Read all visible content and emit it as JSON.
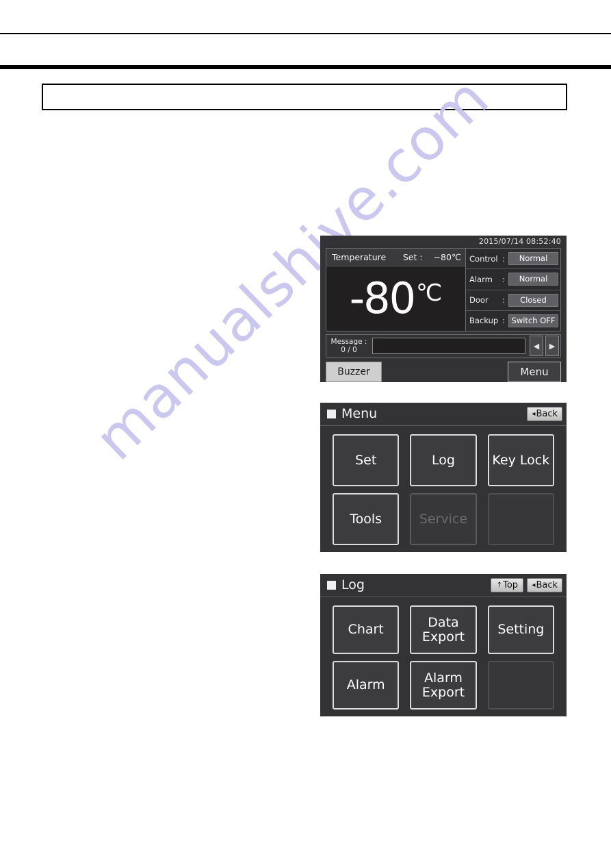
{
  "page": {
    "caption_box_text": "",
    "watermark": "manualshive.com"
  },
  "main_screen": {
    "timestamp": "2015/07/14  08:52:40",
    "temperature": {
      "label": "Temperature",
      "set_label": "Set :",
      "set_value": "−80℃",
      "value": "-80",
      "unit": "℃"
    },
    "status_rows": [
      {
        "key": "Control",
        "colon": ":",
        "value": "Normal"
      },
      {
        "key": "Alarm",
        "colon": ":",
        "value": "Normal"
      },
      {
        "key": "Door",
        "colon": ":",
        "value": "Closed"
      },
      {
        "key": "Backup",
        "colon": ":",
        "value": "Switch OFF"
      }
    ],
    "message": {
      "label": "Message :",
      "counter": "0 / 0",
      "text": "",
      "prev_glyph": "◀",
      "next_glyph": "▶"
    },
    "buzzer_label": "Buzzer",
    "menu_label": "Menu"
  },
  "menu_screen": {
    "title": "Menu",
    "nav": [
      {
        "glyph": "◂",
        "label": "Back"
      }
    ],
    "tiles": [
      {
        "label": "Set",
        "state": "enabled"
      },
      {
        "label": "Log",
        "state": "enabled"
      },
      {
        "label": "Key Lock",
        "state": "enabled"
      },
      {
        "label": "Tools",
        "state": "enabled"
      },
      {
        "label": "Service",
        "state": "disabled"
      },
      {
        "label": "",
        "state": "empty"
      }
    ]
  },
  "log_screen": {
    "title": "Log",
    "nav": [
      {
        "glyph": "↑",
        "label": "Top"
      },
      {
        "glyph": "◂",
        "label": "Back"
      }
    ],
    "tiles": [
      {
        "label": "Chart",
        "state": "enabled"
      },
      {
        "label": "Data\nExport",
        "state": "enabled"
      },
      {
        "label": "Setting",
        "state": "enabled"
      },
      {
        "label": "Alarm",
        "state": "enabled"
      },
      {
        "label": "Alarm\nExport",
        "state": "enabled"
      },
      {
        "label": "",
        "state": "empty"
      }
    ]
  },
  "colors": {
    "screen_bg": "#333234",
    "screen_panel_bg": "#2b2a2c",
    "tile_bg": "#3c3b3e",
    "tile_border": "#dcdcdc",
    "status_chip_bg": "#605f63",
    "buzzer_bg": "#cfcfcf",
    "watermark": "#c9c6ef"
  }
}
